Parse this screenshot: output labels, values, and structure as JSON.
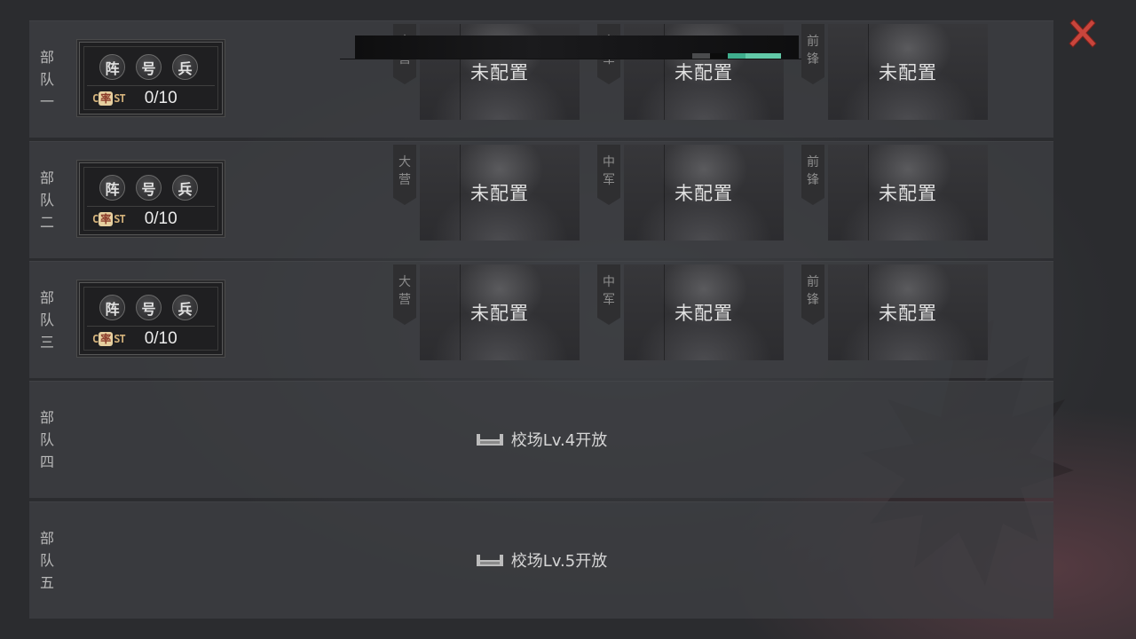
{
  "close_icon": "close-icon",
  "status_bar": {
    "segment_colors": [
      "#4a4b4d",
      "#0c0c0c",
      "#3fae8d",
      "#62c9a8"
    ]
  },
  "troops": [
    {
      "name": "部\n队\n一",
      "tags": [
        "阵",
        "号",
        "兵"
      ],
      "cost_logo": {
        "left": "C",
        "seal": "率",
        "right": "ST"
      },
      "cost": "0/10",
      "slots": [
        {
          "flag": "大\n营",
          "status": "未配置"
        },
        {
          "flag": "中\n军",
          "status": "未配置"
        },
        {
          "flag": "前\n锋",
          "status": "未配置"
        }
      ]
    },
    {
      "name": "部\n队\n二",
      "tags": [
        "阵",
        "号",
        "兵"
      ],
      "cost_logo": {
        "left": "C",
        "seal": "率",
        "right": "ST"
      },
      "cost": "0/10",
      "slots": [
        {
          "flag": "大\n营",
          "status": "未配置"
        },
        {
          "flag": "中\n军",
          "status": "未配置"
        },
        {
          "flag": "前\n锋",
          "status": "未配置"
        }
      ]
    },
    {
      "name": "部\n队\n三",
      "tags": [
        "阵",
        "号",
        "兵"
      ],
      "cost_logo": {
        "left": "C",
        "seal": "率",
        "right": "ST"
      },
      "cost": "0/10",
      "slots": [
        {
          "flag": "大\n营",
          "status": "未配置"
        },
        {
          "flag": "中\n军",
          "status": "未配置"
        },
        {
          "flag": "前\n锋",
          "status": "未配置"
        }
      ]
    },
    {
      "name": "部\n队\n四",
      "locked": true,
      "unlock_text": "校场Lv.4开放",
      "lock_icon": "lock-barrier-icon"
    },
    {
      "name": "部\n队\n五",
      "locked": true,
      "unlock_text": "校场Lv.5开放",
      "lock_icon": "lock-barrier-icon"
    }
  ]
}
